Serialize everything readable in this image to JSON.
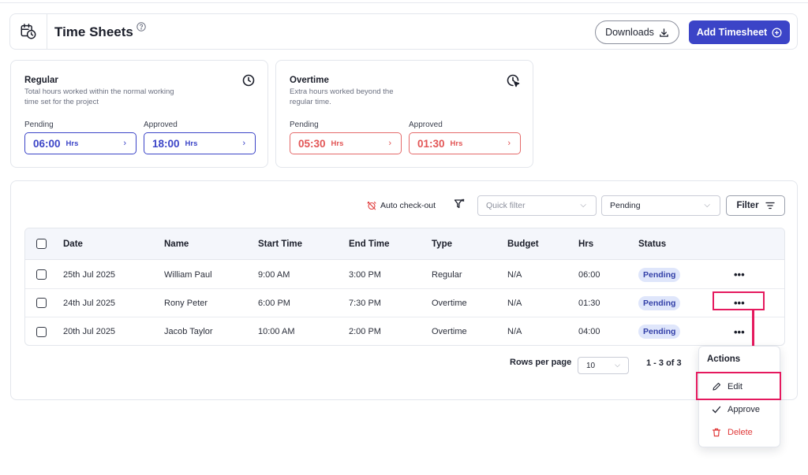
{
  "header": {
    "title": "Time Sheets",
    "downloads_label": "Downloads",
    "add_label": "Add Timesheet"
  },
  "cards": {
    "regular": {
      "title": "Regular",
      "description": "Total hours worked within the normal working time set for the project",
      "pending_label": "Pending",
      "pending_value": "06:00",
      "approved_label": "Approved",
      "approved_value": "18:00",
      "unit": "Hrs",
      "color": "#3b44c7"
    },
    "overtime": {
      "title": "Overtime",
      "description": "Extra hours worked beyond the regular time.",
      "pending_label": "Pending",
      "pending_value": "05:30",
      "approved_label": "Approved",
      "approved_value": "01:30",
      "unit": "Hrs",
      "color": "#e25555"
    }
  },
  "toolbar": {
    "auto_checkout": "Auto check-out",
    "quick_filter_placeholder": "Quick filter",
    "status_value": "Pending",
    "filter_label": "Filter"
  },
  "table": {
    "headers": [
      "Date",
      "Name",
      "Start Time",
      "End Time",
      "Type",
      "Budget",
      "Hrs",
      "Status"
    ],
    "rows": [
      [
        "25th Jul 2025",
        "William Paul",
        "9:00 AM",
        "3:00 PM",
        "Regular",
        "N/A",
        "06:00",
        "Pending"
      ],
      [
        "24th Jul 2025",
        "Rony Peter",
        "6:00 PM",
        "7:30 PM",
        "Overtime",
        "N/A",
        "01:30",
        "Pending"
      ],
      [
        "20th Jul 2025",
        "Jacob Taylor",
        "10:00 AM",
        "2:00 PM",
        "Overtime",
        "N/A",
        "04:00",
        "Pending"
      ]
    ],
    "more_glyph": "•••"
  },
  "pagination": {
    "rows_per_page_label": "Rows per page",
    "rows_per_page_value": "10",
    "range": "1 - 3 of 3"
  },
  "actions_menu": {
    "title": "Actions",
    "edit": "Edit",
    "approve": "Approve",
    "delete": "Delete"
  },
  "colors": {
    "accent": "#3b44c7",
    "highlight": "#e5195e",
    "danger": "#e03a3a"
  }
}
